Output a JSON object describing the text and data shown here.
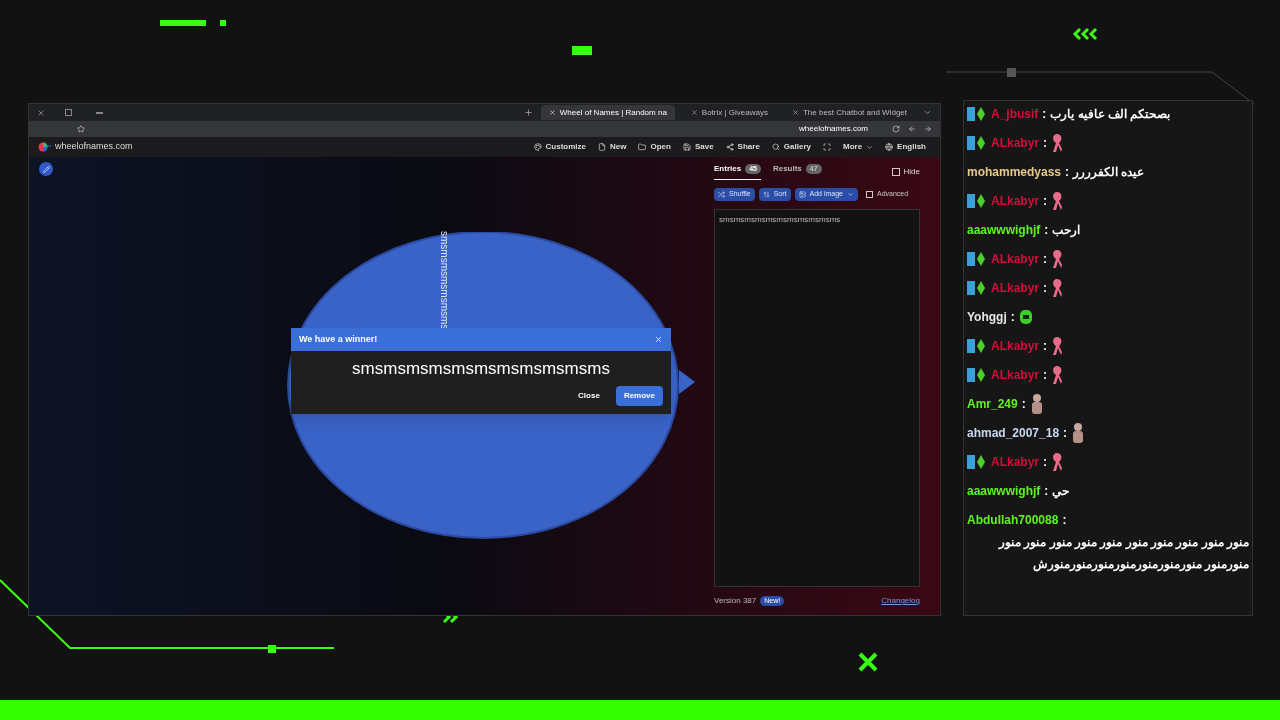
{
  "browser": {
    "tabs": [
      {
        "label": "Wheel of Names | Random na",
        "selected": true
      },
      {
        "label": "Botrix | Giveaways",
        "selected": false
      },
      {
        "label": "The best Chatbot and Widget",
        "selected": false
      }
    ],
    "url": "wheelofnames.com"
  },
  "site": {
    "logo_text": "wheelofnames.com",
    "menu": [
      {
        "label": "Customize",
        "kind": "palette"
      },
      {
        "label": "New",
        "kind": "file"
      },
      {
        "label": "Open",
        "kind": "folder"
      },
      {
        "label": "Save",
        "kind": "save"
      },
      {
        "label": "Share",
        "kind": "share"
      },
      {
        "label": "Gallery",
        "kind": "search"
      },
      {
        "kind": "fullscreen"
      },
      {
        "label": "More",
        "kind": "dropdown"
      },
      {
        "label": "English",
        "kind": "globe"
      }
    ]
  },
  "wheel": {
    "slice_text": "smsmsmsmsmsmsms"
  },
  "dialog": {
    "title": "We have a winner!",
    "winner": "smsmsmsmsmsmsmsmsmsmsms",
    "buttons": [
      {
        "label": "Close",
        "kind": "text"
      },
      {
        "label": "Remove",
        "kind": "primary"
      }
    ]
  },
  "panel": {
    "tabs": [
      {
        "label": "Entries",
        "count": "45",
        "selected": true
      },
      {
        "label": "Results",
        "count": "47",
        "selected": false
      }
    ],
    "hide_label": "Hide",
    "hide_checked": false,
    "tools": [
      "Shuffle",
      "Sort",
      "Add image"
    ],
    "advanced_label": "Advanced",
    "advanced_checked": false,
    "entries_text": "smsmsmsmsmsmsmsmsmsmsms",
    "version": "Version 387",
    "new_badge": "New!",
    "changelog": "Changelog"
  },
  "chat": [
    {
      "user": "A_jbusif",
      "sep": ":",
      "color": "#d0103a",
      "badges": true,
      "kind": "text",
      "text": "بصحتكم الف عافيه يارب"
    },
    {
      "user": "ALkabyr",
      "sep": ":",
      "color": "#d0103a",
      "badges": true,
      "kind": "ribbon"
    },
    {
      "user": "mohammedyass",
      "sep": ":",
      "color": "#e8c98a",
      "badges": false,
      "kind": "text",
      "text": "عيده الكفرررر"
    },
    {
      "user": "ALkabyr",
      "sep": ":",
      "color": "#d0103a",
      "badges": true,
      "kind": "ribbon"
    },
    {
      "user": "aaawwwighjf",
      "sep": ":",
      "color": "#5ef51f",
      "badges": false,
      "kind": "text",
      "text": "ارحب"
    },
    {
      "user": "ALkabyr",
      "sep": ":",
      "color": "#d0103a",
      "badges": true,
      "kind": "ribbon"
    },
    {
      "user": "ALkabyr",
      "sep": ":",
      "color": "#d0103a",
      "badges": true,
      "kind": "ribbon"
    },
    {
      "user": "Yohggj",
      "sep": ":",
      "color": "#e6e6e6",
      "badges": false,
      "kind": "face"
    },
    {
      "user": "ALkabyr",
      "sep": ":",
      "color": "#d0103a",
      "badges": true,
      "kind": "ribbon"
    },
    {
      "user": "ALkabyr",
      "sep": ":",
      "color": "#d0103a",
      "badges": true,
      "kind": "ribbon"
    },
    {
      "user": "Amr_249",
      "sep": ":",
      "color": "#5ef51f",
      "badges": false,
      "kind": "figure"
    },
    {
      "user": "ahmad_2007_18",
      "sep": ":",
      "color": "#c8d8f0",
      "badges": false,
      "kind": "figure"
    },
    {
      "user": "ALkabyr",
      "sep": ":",
      "color": "#d0103a",
      "badges": true,
      "kind": "ribbon"
    },
    {
      "user": "aaawwwighjf",
      "sep": ":",
      "color": "#5ef51f",
      "badges": false,
      "kind": "text",
      "text": "حي"
    },
    {
      "user": "Abdullah700088",
      "sep": ":",
      "color": "#5ef51f",
      "badges": false,
      "kind": "text",
      "text": "منور منور منور منور منور منور منور منور منور منور منورمنور منورمنورمنورمنورمنورمنورمنورش"
    }
  ]
}
